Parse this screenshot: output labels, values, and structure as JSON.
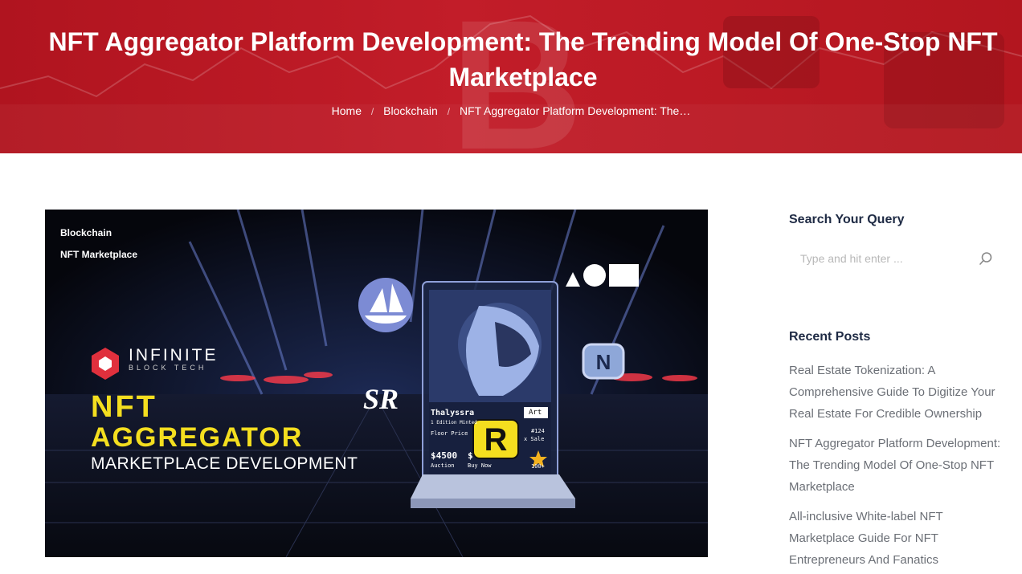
{
  "hero": {
    "title": "NFT Aggregator Platform Development: The Trending Model Of One-Stop NFT Marketplace",
    "breadcrumb": [
      "Home",
      "Blockchain",
      "NFT Aggregator Platform Development: The…"
    ]
  },
  "featured": {
    "categories": [
      "Blockchain",
      "NFT Marketplace"
    ],
    "brand": {
      "name": "INFINITE",
      "sub": "BLOCK TECH"
    },
    "headline_line1": "NFT",
    "headline_line2": "AGGREGATOR",
    "headline_line3": "MARKETPLACE DEVELOPMENT",
    "logos": {
      "sr": "SR",
      "aoe": "AOE",
      "n": "N",
      "r": "R"
    },
    "card": {
      "name": "Thalyssra",
      "tag": "Art",
      "edition": "1 Edition Minted",
      "floor_label": "Floor Price",
      "id": "#124",
      "sale": "x Sale",
      "price1": "$4500",
      "price1_label": "Auction",
      "price2": "$",
      "price2_label": "Buy Now",
      "likes": "100+"
    },
    "accent_yellow": "#f4de1f"
  },
  "sidebar": {
    "search_heading": "Search Your Query",
    "search_placeholder": "Type and hit enter ...",
    "recent_heading": "Recent Posts",
    "recent_posts": [
      "Real Estate Tokenization: A Comprehensive Guide To Digitize Your Real Estate For Credible Ownership",
      "NFT Aggregator Platform Development: The Trending Model Of One-Stop NFT Marketplace",
      "All-inclusive White-label NFT Marketplace Guide For NFT Entrepreneurs And Fanatics"
    ]
  },
  "colors": {
    "hero_red": "#b8181f",
    "heading_navy": "#1e2a44",
    "link_gray": "#6b6f76"
  }
}
